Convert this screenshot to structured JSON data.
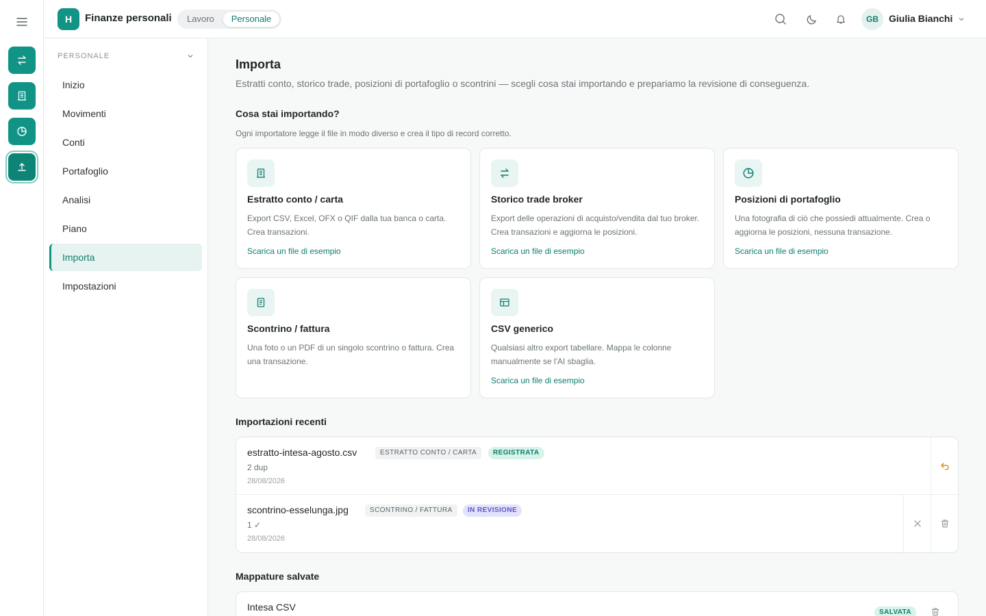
{
  "app": {
    "logo_letter": "H",
    "title": "Finanze personali",
    "workspace_options": [
      "Lavoro",
      "Personale"
    ],
    "workspace_selected": "Personale"
  },
  "user": {
    "initials": "GB",
    "name": "Giulia Bianchi"
  },
  "colors": {
    "accent": "#119485",
    "accent_dark": "#0f7d70",
    "badge_green": "#d7f3ea",
    "badge_purple": "#e3e2fb",
    "undo_orange": "#e08a1e"
  },
  "rail": {
    "items": [
      {
        "icon": "arrows-exchange-icon"
      },
      {
        "icon": "receipt-icon"
      },
      {
        "icon": "pie-chart-icon"
      },
      {
        "icon": "upload-icon",
        "active": true
      }
    ]
  },
  "sidebar": {
    "section": "PERSONALE",
    "items": [
      {
        "label": "Inizio"
      },
      {
        "label": "Movimenti"
      },
      {
        "label": "Conti"
      },
      {
        "label": "Portafoglio"
      },
      {
        "label": "Analisi"
      },
      {
        "label": "Piano"
      },
      {
        "label": "Importa",
        "active": true
      },
      {
        "label": "Impostazioni"
      }
    ]
  },
  "page": {
    "title": "Importa",
    "subtitle": "Estratti conto, storico trade, posizioni di portafoglio o scontrini — scegli cosa stai importando e prepariamo la revisione di conseguenza.",
    "question": "Cosa stai importando?",
    "hint": "Ogni importatore legge il file in modo diverso e crea il tipo di record corretto."
  },
  "importers": [
    {
      "icon": "receipt-icon",
      "title": "Estratto conto / carta",
      "desc": "Export CSV, Excel, OFX o QIF dalla tua banca o carta. Crea transazioni.",
      "link": "Scarica un file di esempio"
    },
    {
      "icon": "arrows-exchange-icon",
      "title": "Storico trade broker",
      "desc": "Export delle operazioni di acquisto/vendita dal tuo broker. Crea transazioni e aggiorna le posizioni.",
      "link": "Scarica un file di esempio"
    },
    {
      "icon": "pie-chart-icon",
      "title": "Posizioni di portafoglio",
      "desc": "Una fotografia di ciò che possiedi attualmente. Crea o aggiorna le posizioni, nessuna transazione.",
      "link": "Scarica un file di esempio"
    },
    {
      "icon": "document-icon",
      "title": "Scontrino / fattura",
      "desc": "Una foto o un PDF di un singolo scontrino o fattura. Crea una transazione.",
      "link": ""
    },
    {
      "icon": "table-icon",
      "title": "CSV generico",
      "desc": "Qualsiasi altro export tabellare. Mappa le colonne manualmente se l'AI sbaglia.",
      "link": "Scarica un file di esempio"
    }
  ],
  "recent": {
    "title": "Importazioni recenti",
    "items": [
      {
        "file": "estratto-intesa-agosto.csv",
        "type": "ESTRATTO CONTO / CARTA",
        "status": "REGISTRATA",
        "meta": "2 dup",
        "date": "28/08/2026"
      },
      {
        "file": "scontrino-esselunga.jpg",
        "type": "SCONTRINO / FATTURA",
        "status": "IN REVISIONE",
        "meta": "1 ✓",
        "date": "28/08/2026"
      }
    ]
  },
  "mappings": {
    "title": "Mappature salvate",
    "items": [
      {
        "name": "Intesa CSV",
        "status": "SALVATA"
      }
    ]
  }
}
